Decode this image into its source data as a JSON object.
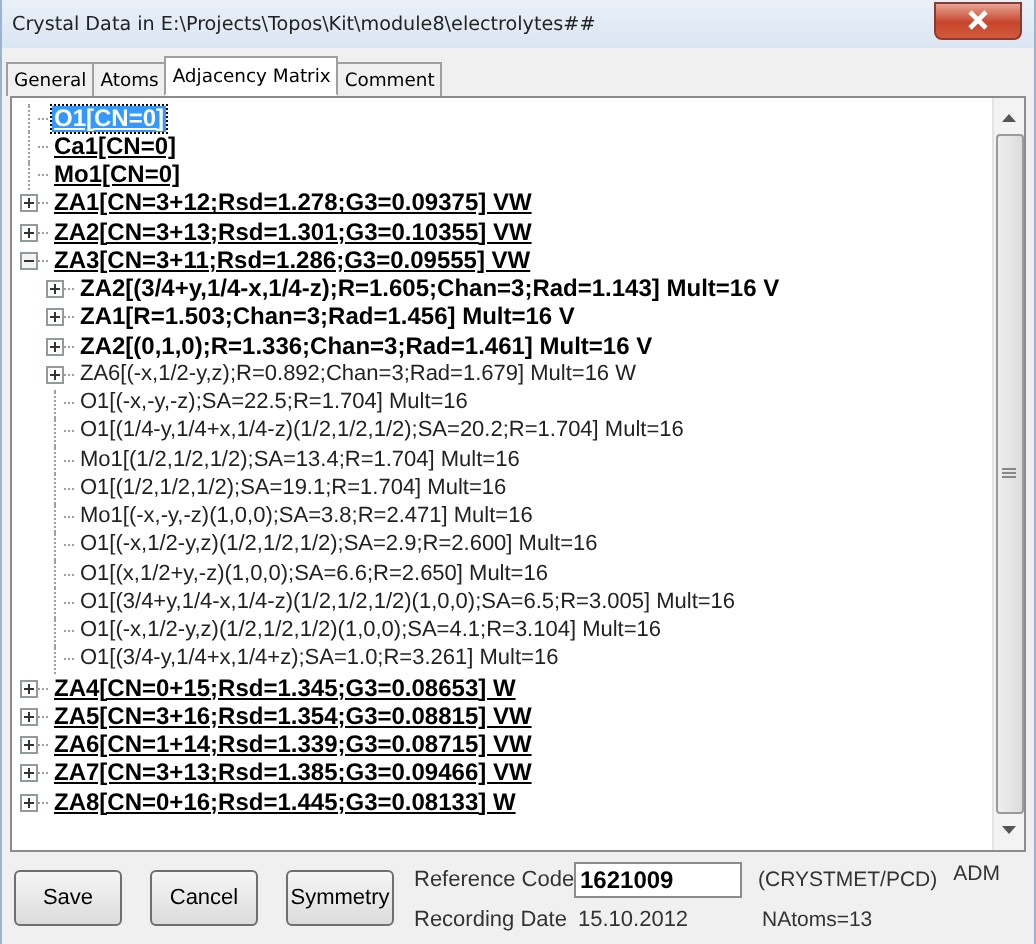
{
  "window": {
    "title": "Crystal Data in E:\\Projects\\Topos\\Kit\\module8\\electrolytes##"
  },
  "tabs": [
    {
      "label": "General",
      "selected": false
    },
    {
      "label": "Atoms",
      "selected": false
    },
    {
      "label": "Adjacency Matrix",
      "selected": true
    },
    {
      "label": "Comment",
      "selected": false
    }
  ],
  "tree": [
    {
      "label": "O1[CN=0]",
      "kind": "cluster",
      "expandable": false,
      "selected": true
    },
    {
      "label": "Ca1[CN=0]",
      "kind": "cluster",
      "expandable": false,
      "selected": false
    },
    {
      "label": "Mo1[CN=0]",
      "kind": "cluster",
      "expandable": false,
      "selected": false
    },
    {
      "label": "ZA1[CN=3+12;Rsd=1.278;G3=0.09375] VW",
      "kind": "cluster",
      "expandable": true,
      "expanded": false,
      "selected": false
    },
    {
      "label": "ZA2[CN=3+13;Rsd=1.301;G3=0.10355] VW",
      "kind": "cluster",
      "expandable": true,
      "expanded": false,
      "selected": false
    },
    {
      "label": "ZA3[CN=3+11;Rsd=1.286;G3=0.09555] VW",
      "kind": "cluster",
      "expandable": true,
      "expanded": true,
      "selected": false,
      "children": [
        {
          "label": "ZA2[(3/4+y,1/4-x,1/4-z);R=1.605;Chan=3;Rad=1.143] Mult=16 V",
          "kind": "strong",
          "expandable": true,
          "expanded": false,
          "selected": false
        },
        {
          "label": "ZA1[R=1.503;Chan=3;Rad=1.456] Mult=16 V",
          "kind": "strong",
          "expandable": true,
          "expanded": false,
          "selected": false
        },
        {
          "label": "ZA2[(0,1,0);R=1.336;Chan=3;Rad=1.461] Mult=16 V",
          "kind": "strong",
          "expandable": true,
          "expanded": false,
          "selected": false
        },
        {
          "label": "ZA6[(-x,1/2-y,z);R=0.892;Chan=3;Rad=1.679] Mult=16 W",
          "kind": "plain",
          "expandable": true,
          "expanded": false,
          "selected": false
        },
        {
          "label": "O1[(-x,-y,-z);SA=22.5;R=1.704] Mult=16",
          "kind": "plain",
          "expandable": false,
          "selected": false
        },
        {
          "label": "O1[(1/4-y,1/4+x,1/4-z)(1/2,1/2,1/2);SA=20.2;R=1.704] Mult=16",
          "kind": "plain",
          "expandable": false,
          "selected": false
        },
        {
          "label": "Mo1[(1/2,1/2,1/2);SA=13.4;R=1.704] Mult=16",
          "kind": "plain",
          "expandable": false,
          "selected": false
        },
        {
          "label": "O1[(1/2,1/2,1/2);SA=19.1;R=1.704] Mult=16",
          "kind": "plain",
          "expandable": false,
          "selected": false
        },
        {
          "label": "Mo1[(-x,-y,-z)(1,0,0);SA=3.8;R=2.471] Mult=16",
          "kind": "plain",
          "expandable": false,
          "selected": false
        },
        {
          "label": "O1[(-x,1/2-y,z)(1/2,1/2,1/2);SA=2.9;R=2.600] Mult=16",
          "kind": "plain",
          "expandable": false,
          "selected": false
        },
        {
          "label": "O1[(x,1/2+y,-z)(1,0,0);SA=6.6;R=2.650] Mult=16",
          "kind": "plain",
          "expandable": false,
          "selected": false
        },
        {
          "label": "O1[(3/4+y,1/4-x,1/4-z)(1/2,1/2,1/2)(1,0,0);SA=6.5;R=3.005] Mult=16",
          "kind": "plain",
          "expandable": false,
          "selected": false
        },
        {
          "label": "O1[(-x,1/2-y,z)(1/2,1/2,1/2)(1,0,0);SA=4.1;R=3.104] Mult=16",
          "kind": "plain",
          "expandable": false,
          "selected": false
        },
        {
          "label": "O1[(3/4-y,1/4+x,1/4+z);SA=1.0;R=3.261] Mult=16",
          "kind": "plain",
          "expandable": false,
          "selected": false
        }
      ]
    },
    {
      "label": "ZA4[CN=0+15;Rsd=1.345;G3=0.08653] W",
      "kind": "cluster",
      "expandable": true,
      "expanded": false,
      "selected": false
    },
    {
      "label": "ZA5[CN=3+16;Rsd=1.354;G3=0.08815] VW",
      "kind": "cluster",
      "expandable": true,
      "expanded": false,
      "selected": false
    },
    {
      "label": "ZA6[CN=1+14;Rsd=1.339;G3=0.08715] VW",
      "kind": "cluster",
      "expandable": true,
      "expanded": false,
      "selected": false
    },
    {
      "label": "ZA7[CN=3+13;Rsd=1.385;G3=0.09466] VW",
      "kind": "cluster",
      "expandable": true,
      "expanded": false,
      "selected": false
    },
    {
      "label": "ZA8[CN=0+16;Rsd=1.445;G3=0.08133] W",
      "kind": "cluster",
      "expandable": true,
      "expanded": false,
      "selected": false
    }
  ],
  "buttons": [
    "Save",
    "Cancel",
    "Symmetry"
  ],
  "reference_code": {
    "label": "Reference Code",
    "value": "1621009",
    "source": "(CRYSTMET/PCD)",
    "tag": "ADM"
  },
  "recording_date": {
    "label": "Recording Date",
    "value": "15.10.2012"
  },
  "natoms": "NAtoms=13"
}
